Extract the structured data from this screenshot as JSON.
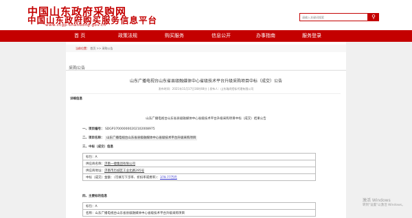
{
  "header": {
    "logo_main": "中国山东政府采购网",
    "logo_sub": "中国山东政府购买服务信息平台",
    "logo_url": "www.ccgp-shandong.gov.cn",
    "search_placeholder": "请输入关键词搜索",
    "search_icon": "search-icon"
  },
  "nav": {
    "items": [
      "首  页",
      "政策法规",
      "购买服务",
      "信息公开",
      "办事指南",
      "服务登录"
    ]
  },
  "breadcrumb": {
    "label": "当前位置：",
    "path": "首页  >>  采购公告"
  },
  "tab_label": "采购公告",
  "notice": {
    "title": "山东广播电视台山东省县级融媒体中心省级技术平台升级采购项目中标（成交）公告",
    "meta": "发布时间：2021年11月17日16时48分  |  发布人：山东瑞尚招标代理有限公司",
    "detail_label": "详细信息",
    "inner_title": "山东广播电视台山东省县级融媒体中心省级技术平台升级采购项目中标（成交）结果公告",
    "project_no_label": "一、项目编号：",
    "project_no": "SDGP370000000202102008975",
    "project_name_label": "二、项目名称：",
    "project_name": "山东广播电视台山东省县级融媒体中心省级技术平台升级采购项目",
    "section3": "三、中标（成交）信息",
    "table1": {
      "r1": "标包：A",
      "r2_label": "供应商名称：",
      "r2_val": "济南一捷集团有限公司",
      "r3_label": "供应商地址：",
      "r3_val": "济南市历城区工业北路295号",
      "r4_label": "中标（成交）金额：（可填写下浮率、折扣率或费率）：",
      "r4_val": "379.77万元"
    },
    "section4": "四、主要标的信息",
    "table2": {
      "r1": "标包：A",
      "r2": "名称：山东广播电视台山东省县级融媒体中心省级技术平台升级采购项目"
    }
  },
  "watermark": {
    "line1": "激活 Windows",
    "line2": "转到\"设置\"以激活 Windows。"
  }
}
